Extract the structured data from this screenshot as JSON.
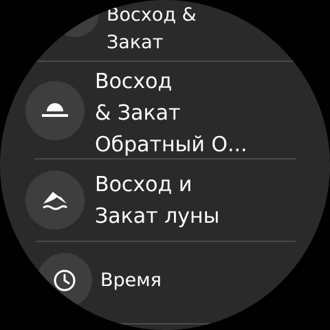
{
  "list": {
    "items": [
      {
        "label": "Восход &\nЗакат",
        "icon": "sunset-icon"
      },
      {
        "label": "Восход\n& Закат\nОбратный О...",
        "icon": "sunrise-icon"
      },
      {
        "label": "Восход и\nЗакат луны",
        "icon": "moon-horizon-icon"
      },
      {
        "label": "Время",
        "icon": "clock-icon"
      }
    ]
  },
  "colors": {
    "background": "#2a2a2a",
    "icon_circle": "#3e3e3e",
    "divider": "#4a4a4a",
    "text": "#ffffff"
  }
}
